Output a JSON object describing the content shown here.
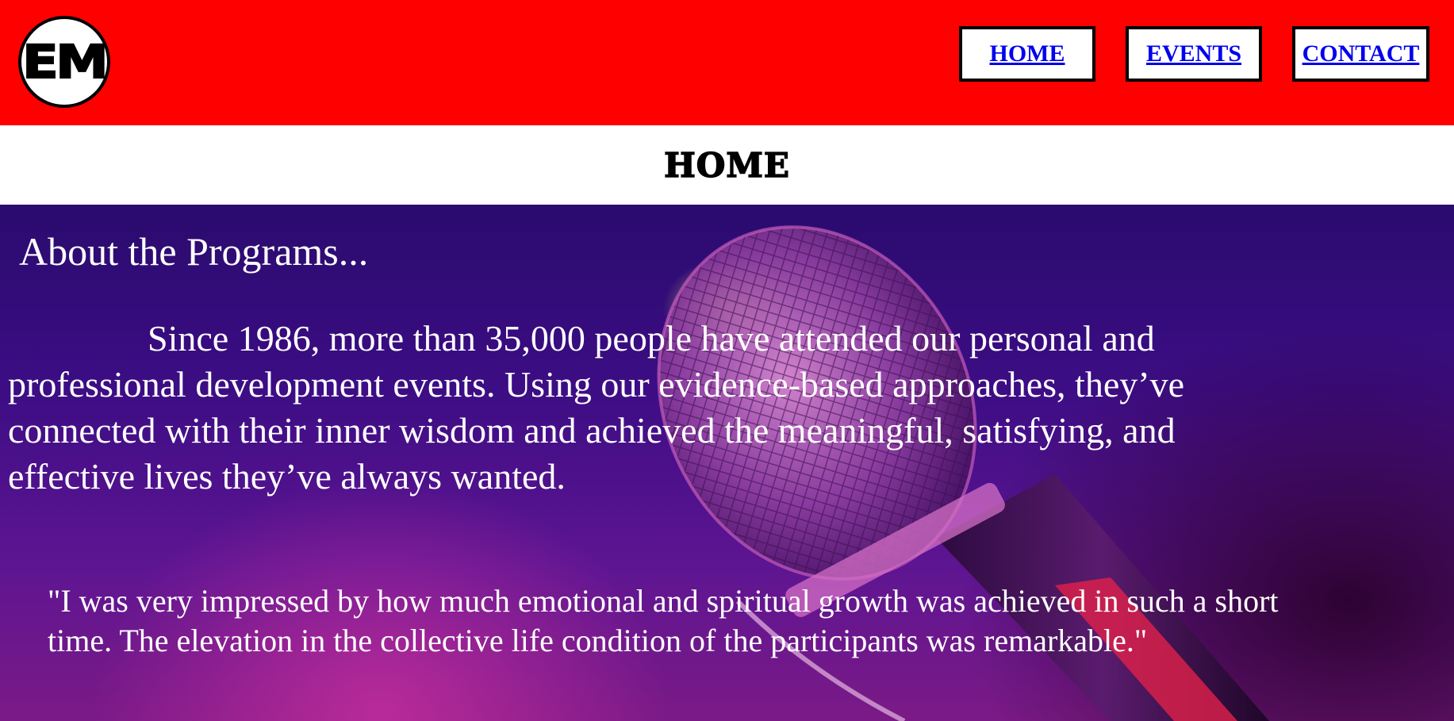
{
  "logo": {
    "text": "EM"
  },
  "nav": {
    "home": "HOME",
    "events": "EVENTS",
    "contact": "CONTACT"
  },
  "page_title": "HOME",
  "about": {
    "heading": "About the Programs...",
    "body": "Since 1986, more than 35,000 people have attended our personal and professional development events. Using our evidence-based approaches, they’ve connected with their inner wisdom and achieved the meaningful, satisfying, and effective lives they’ve always wanted.",
    "quote": "\"I was very impressed by how much emotional and spiritual growth was achieved in such a short time. The elevation in the collective life condition of the participants was remarkable.\""
  },
  "colors": {
    "header_bg": "#ff0000",
    "link": "#0000ee",
    "hero_base": "#3c0d84"
  },
  "icons": [
    "microphone-image"
  ]
}
